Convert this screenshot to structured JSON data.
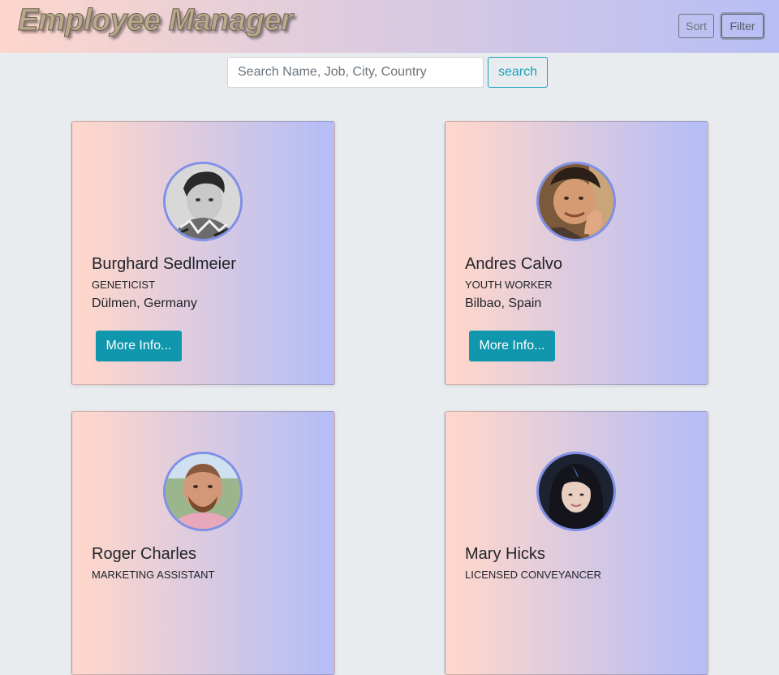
{
  "header": {
    "brand": "Employee Manager",
    "sort_label": "Sort",
    "filter_label": "Filter"
  },
  "search": {
    "placeholder": "Search Name, Job, City, Country",
    "value": "",
    "button_label": "search"
  },
  "colors": {
    "gradient_start": "#fdd6cc",
    "gradient_end": "#b7bef5",
    "accent": "#1197ad",
    "avatar_ring": "#7f90e6"
  },
  "employees": [
    {
      "name": "Burghard Sedlmeier",
      "job": "GENETICIST",
      "location": "Dülmen, Germany",
      "button_label": "More Info..."
    },
    {
      "name": "Andres Calvo",
      "job": "YOUTH WORKER",
      "location": "Bilbao, Spain",
      "button_label": "More Info..."
    },
    {
      "name": "Roger Charles",
      "job": "MARKETING ASSISTANT",
      "location": "",
      "button_label": ""
    },
    {
      "name": "Mary Hicks",
      "job": "LICENSED CONVEYANCER",
      "location": "",
      "button_label": ""
    }
  ]
}
